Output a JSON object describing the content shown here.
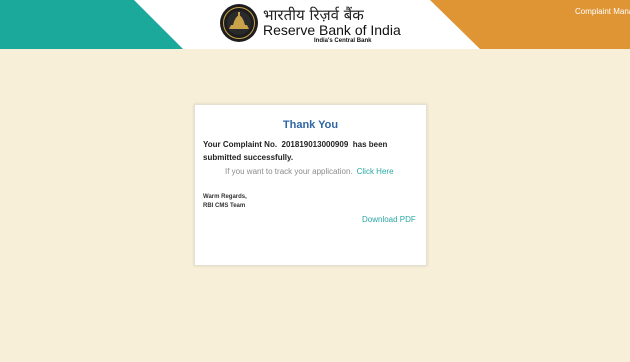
{
  "header": {
    "brand_hindi": "भारतीय रिज़र्व बैंक",
    "brand_english": "Reserve Bank of India",
    "tagline": "India's Central Bank",
    "nav_link": "Complaint Manag",
    "colors": {
      "teal": "#1ba99c",
      "orange": "#df9533"
    },
    "logo_icon": "rbi-emblem-icon"
  },
  "card": {
    "title": "Thank You",
    "message_prefix": "Your Complaint No.",
    "complaint_number": "201819013000909",
    "message_suffix": "has been submitted successfully.",
    "track_text": "If you want to track your application.",
    "track_link": "Click Here",
    "regards_line1": "Warm Regards,",
    "regards_line2": "RBI CMS Team",
    "download_link": "Download PDF"
  }
}
